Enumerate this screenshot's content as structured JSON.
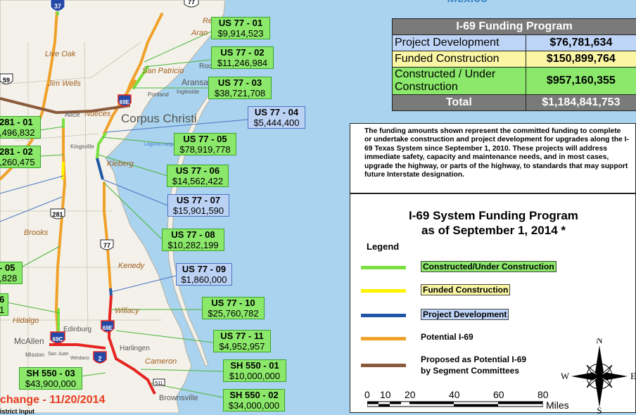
{
  "gulf_label": "Mexico",
  "funding_table": {
    "title": "I-69 Funding Program",
    "rows": [
      {
        "label": "Project Development",
        "amount": "$76,781,634",
        "color": "#bfd5f7"
      },
      {
        "label": "Funded Construction",
        "amount": "$150,899,764",
        "color": "#fbf6a4"
      },
      {
        "label": "Constructed / Under Construction",
        "amount": "$957,160,355",
        "color": "#8be86a"
      }
    ],
    "total_label": "Total",
    "total_amount": "$1,184,841,753"
  },
  "note": "The funding amounts shown represent the committed funding to complete or undertake construction and project development for upgrades along the I-69 Texas System since September 1, 2010. These projects will address immediate safety, capacity and maintenance needs, and in most cases, upgrade the highway, or parts of the highway, to standards that may support future Interstate designation.",
  "legend": {
    "title_line1": "I-69 System Funding Program",
    "title_line2": "as of September 1, 2014 *",
    "heading": "Legend",
    "items": [
      {
        "label": "Constructed/Under Construction",
        "color": "#7be03f"
      },
      {
        "label": "Funded Construction",
        "color": "#fff200"
      },
      {
        "label": "Project Development",
        "color": "#1f57a6"
      },
      {
        "label": "Potential I-69",
        "color": "#f0a12a"
      },
      {
        "label": "Proposed as Potential I-69",
        "label2": "by Segment Committees",
        "color": "#8b5a3c"
      }
    ],
    "scale_ticks": [
      "0",
      "10",
      "20",
      "40",
      "60",
      "80"
    ],
    "scale_unit": "Miles",
    "compass": {
      "n": "N",
      "s": "S",
      "e": "E",
      "w": "W"
    }
  },
  "projects": [
    {
      "code": "US 77 - 01",
      "amount": "$9,914,523"
    },
    {
      "code": "US 77 - 02",
      "amount": "$11,246,984"
    },
    {
      "code": "US 77 - 03",
      "amount": "$38,721,708"
    },
    {
      "code": "US 77 - 04",
      "amount": "$5,444,400"
    },
    {
      "code": "US 77 - 05",
      "amount": "$78,919,778"
    },
    {
      "code": "US 77 - 06",
      "amount": "$14,562,422"
    },
    {
      "code": "US 77 - 07",
      "amount": "$15,901,590"
    },
    {
      "code": "US 77 - 08",
      "amount": "$10,282,199"
    },
    {
      "code": "US 77 - 09",
      "amount": "$1,860,000"
    },
    {
      "code": "US 77 - 10",
      "amount": "$25,760,782"
    },
    {
      "code": "US 77 - 11",
      "amount": "$4,952,957"
    },
    {
      "code": "SH 550 - 01",
      "amount": "$10,000,000"
    },
    {
      "code": "SH 550 - 02",
      "amount": "$34,000,000"
    },
    {
      "code": "SH 550 - 03",
      "amount": "$43,900,000"
    },
    {
      "code": "281 - 01",
      "amount": ",496,832"
    },
    {
      "code": "281 - 02",
      "amount": ",260,475"
    },
    {
      "code": "- 05",
      "amount": ",828"
    },
    {
      "code": "6",
      "amount": "1"
    }
  ],
  "places": {
    "refugio": "Refugio",
    "aransas": "Aran",
    "live_oak": "Live Oak",
    "jim_wells": "Jim Wells",
    "san_patricio": "San Patricio",
    "rockport": "Rock",
    "aransas_pass": "Aransas P",
    "ingleside": "Ingleside",
    "portland": "Portland",
    "corpus_christi": "Corpus Christi",
    "alice": "Alice",
    "nueces": "Nueces",
    "kingsville": "Kingsville",
    "kleberg": "Kleberg",
    "laguna_larga": "Laguna Larga",
    "brooks": "Brooks",
    "kenedy": "Kenedy",
    "willacy": "Willacy",
    "hidalgo": "Hidalgo",
    "edinburg": "Edinburg",
    "mcallen": "McAllen",
    "mission": "Mission",
    "harlingen": "Harlingen",
    "cameron": "Cameron",
    "brownsville": "Brownsville",
    "weslaco": "Weslaco",
    "san_juan": "San Juan"
  },
  "shields": {
    "i37": "37",
    "us59": "59",
    "us281": "281",
    "us77": "77",
    "i69e_1": "69E",
    "i69e_2": "69E",
    "i69c": "69C",
    "i2": "2",
    "sh511": "511",
    "us77_top": "77"
  },
  "footer": {
    "change": "change - 11/20/2014",
    "district": "istrict Input"
  }
}
